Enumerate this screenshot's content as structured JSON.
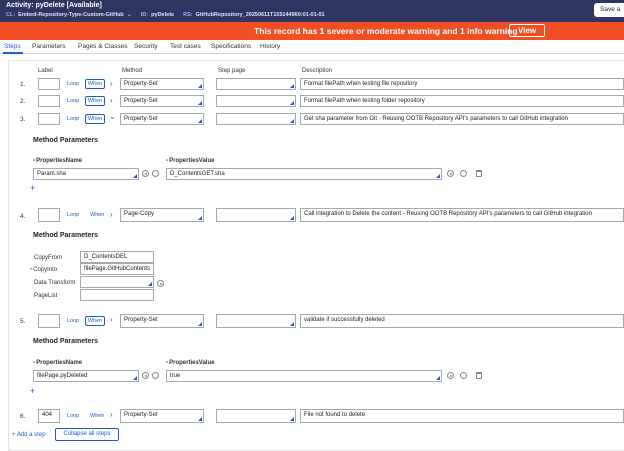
{
  "header": {
    "title": "Activity: pyDelete [Available]",
    "cl_label": "CL:",
    "cl_value": "Embed-Repository-Type-Custom-GitHub",
    "id_label": "ID:",
    "id_value": "pyDelete",
    "rs_label": "RS:",
    "rs_value": "GitHubRepository_20250611T155144960:01-01-01",
    "save_label": "Save a"
  },
  "banner": {
    "message": "This record has 1 severe or moderate warning and 1 info warning",
    "view_label": "View"
  },
  "tabs": [
    "Steps",
    "Parameters",
    "Pages & Classes",
    "Security",
    "Test cases",
    "Specifications",
    "History"
  ],
  "columns": {
    "label": "Label",
    "method": "Method",
    "step_page": "Step page",
    "description": "Description"
  },
  "common": {
    "loop": "Loop",
    "when": "When",
    "method_params": "Method Parameters",
    "properties_name": "PropertiesName",
    "properties_value": "PropertiesValue"
  },
  "steps": [
    {
      "num": "1.",
      "label": "",
      "method": "Property-Set",
      "page": "",
      "desc": "Format filePath when testing file repository"
    },
    {
      "num": "2.",
      "label": "",
      "method": "Property-Set",
      "page": "",
      "desc": "Format filePath when testing folder repository"
    },
    {
      "num": "3.",
      "label": "",
      "method": "Property-Set",
      "page": "",
      "desc": "Get sha parameter from Git - Reusing OOTB Repository API's parameters to call GitHub integration"
    },
    {
      "num": "4.",
      "label": "",
      "method": "Page-Copy",
      "page": "",
      "desc": "Call integration to Delete the content - Reusing OOTB Repository API's parameters to call GitHub integration"
    },
    {
      "num": "5.",
      "label": "",
      "method": "Property-Set",
      "page": "",
      "desc": "validate if successfully deleted"
    },
    {
      "num": "6.",
      "label": "404",
      "method": "Property-Set",
      "page": "",
      "desc": "File not found to delete"
    }
  ],
  "step3_params": {
    "name": "Param.sha",
    "value": "D_ContentsGET.sha"
  },
  "step4_params": {
    "copyfrom_label": "CopyFrom",
    "copyfrom_value": "D_ContentsDEL",
    "copyinto_label": "CopyInto",
    "copyinto_value": "filePage.GitHubContents",
    "transform_label": "Data Transform",
    "transform_value": "",
    "pagelist_label": "PageList",
    "pagelist_value": ""
  },
  "step5_params": {
    "name": "filePage.pyDeleted",
    "value": "true"
  },
  "footer": {
    "add_step": "+ Add a step",
    "collapse_all": "Collapse all steps"
  },
  "colors": {
    "header_bg": "#2e3560",
    "banner_bg": "#f04e23",
    "accent": "#1f5bd0",
    "required": "#e07b00"
  }
}
